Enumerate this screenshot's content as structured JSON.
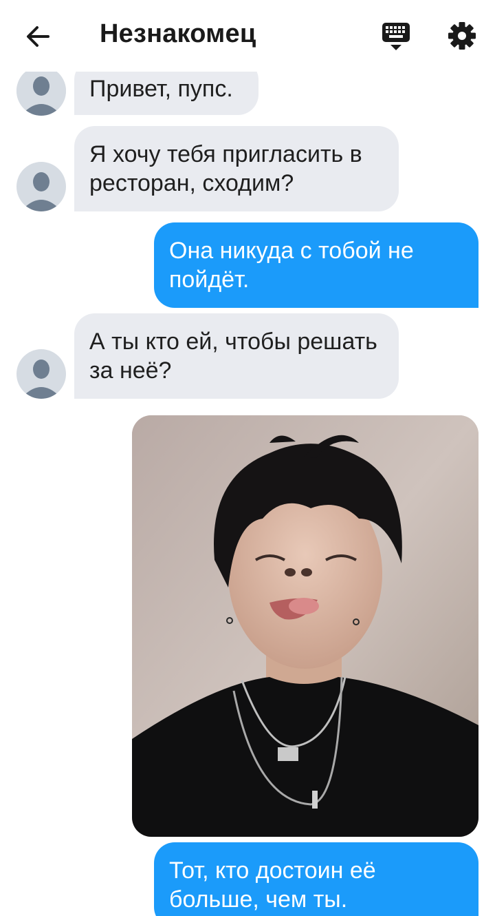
{
  "header": {
    "title": "Незнакомец",
    "back_icon": "arrow-left-icon",
    "keyboard_icon": "keyboard-icon",
    "settings_icon": "gear-icon"
  },
  "messages": [
    {
      "side": "in",
      "text": "Привет, пупс."
    },
    {
      "side": "in",
      "text": "Я хочу тебя пригласить в ресторан, сходим?"
    },
    {
      "side": "out",
      "text": "Она никуда с тобой не пойдёт."
    },
    {
      "side": "in",
      "text": "А ты кто ей, чтобы решать за неё?"
    },
    {
      "side": "out",
      "type": "photo"
    },
    {
      "side": "out",
      "text": "Тот, кто достоин её больше, чем ты."
    }
  ],
  "colors": {
    "incoming_bubble": "#e9ebf0",
    "outgoing_bubble": "#1b9bfa",
    "avatar_bg": "#d6dce3",
    "avatar_fg": "#6f7f91"
  }
}
